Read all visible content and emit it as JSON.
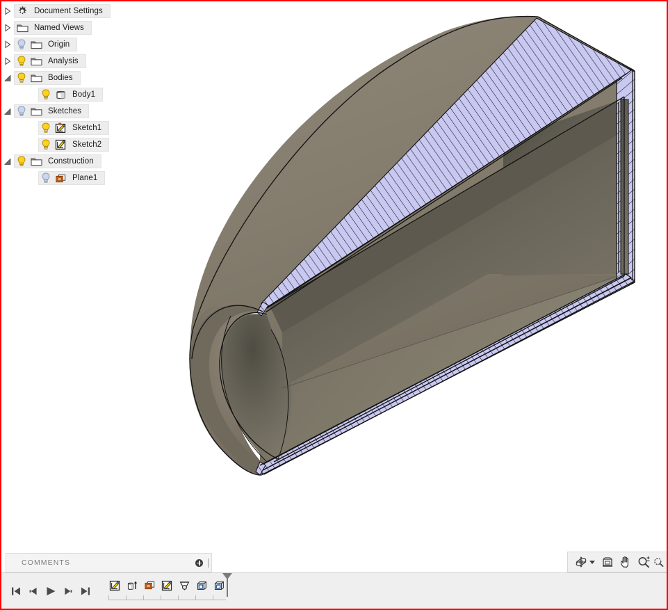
{
  "window": {
    "border_color": "#ff0000",
    "canvas_background": "#ffffff"
  },
  "browser": {
    "name": "browser-tree",
    "items": [
      {
        "label": "Document Settings",
        "icon": "gear-icon",
        "expander": "collapsed",
        "bulb": "none",
        "depth": 0
      },
      {
        "label": "Named Views",
        "icon": "folder-icon",
        "expander": "collapsed",
        "bulb": "none",
        "depth": 0
      },
      {
        "label": "Origin",
        "icon": "folder-icon",
        "expander": "collapsed",
        "bulb": "off",
        "depth": 0
      },
      {
        "label": "Analysis",
        "icon": "folder-icon",
        "expander": "collapsed",
        "bulb": "on",
        "depth": 0
      },
      {
        "label": "Bodies",
        "icon": "folder-icon",
        "expander": "expanded",
        "bulb": "on",
        "depth": 0
      },
      {
        "label": "Body1",
        "icon": "body-icon",
        "expander": "none",
        "bulb": "on",
        "depth": 1
      },
      {
        "label": "Sketches",
        "icon": "folder-icon",
        "expander": "expanded",
        "bulb": "off",
        "depth": 0
      },
      {
        "label": "Sketch1",
        "icon": "sketch-pin-icon",
        "expander": "none",
        "bulb": "on",
        "depth": 1
      },
      {
        "label": "Sketch2",
        "icon": "sketch-icon",
        "expander": "none",
        "bulb": "on",
        "depth": 1
      },
      {
        "label": "Construction",
        "icon": "folder-icon",
        "expander": "expanded",
        "bulb": "on",
        "depth": 0
      },
      {
        "label": "Plane1",
        "icon": "plane-icon",
        "expander": "none",
        "bulb": "off",
        "depth": 1
      }
    ]
  },
  "comments": {
    "label": "COMMENTS",
    "add_icon": "plus-circle-icon",
    "grip_icon": "resize-grip-icon"
  },
  "navbar": {
    "buttons": [
      {
        "name": "orbit-icon",
        "title": "Orbit"
      },
      {
        "name": "chevron-down-icon",
        "title": "Orbit options"
      },
      {
        "name": "look-at-icon",
        "title": "Look At"
      },
      {
        "name": "pan-icon",
        "title": "Pan"
      },
      {
        "name": "zoom-icon",
        "title": "Zoom"
      },
      {
        "name": "fit-icon",
        "title": "Fit"
      }
    ]
  },
  "timeline": {
    "playback": [
      {
        "name": "skip-to-start-button",
        "glyph": "skip-start"
      },
      {
        "name": "step-back-button",
        "glyph": "step-back"
      },
      {
        "name": "play-button",
        "glyph": "play"
      },
      {
        "name": "step-forward-button",
        "glyph": "step-forward"
      },
      {
        "name": "skip-to-end-button",
        "glyph": "skip-end"
      }
    ],
    "features": [
      {
        "name": "timeline-feature-sketch1",
        "icon": "sketch-icon",
        "tooltip": "Sketch1"
      },
      {
        "name": "timeline-feature-extrude1",
        "icon": "extrude-icon",
        "tooltip": "Extrude1"
      },
      {
        "name": "timeline-feature-plane1",
        "icon": "plane-icon",
        "tooltip": "Plane1"
      },
      {
        "name": "timeline-feature-sketch2",
        "icon": "sketch-icon",
        "tooltip": "Sketch2"
      },
      {
        "name": "timeline-feature-loft1",
        "icon": "loft-icon",
        "tooltip": "Loft1"
      },
      {
        "name": "timeline-feature-shell1",
        "icon": "shell-icon",
        "tooltip": "Shell1"
      },
      {
        "name": "timeline-feature-fillet1",
        "icon": "fillet-icon",
        "tooltip": "Fillet1"
      }
    ],
    "marker": "timeline-end-marker"
  },
  "model": {
    "name": "lofted-shelled-body",
    "body_color": "#7d7768",
    "body_color_light": "#908a7b",
    "body_color_dark": "#5d5950",
    "inner_color": "#6e6a5e",
    "section_fill": "#c7c7ee",
    "edge_color": "#1a1a1a",
    "description": "Isometric view of a lofted, shelled solid cut by a section plane; cut faces shown with lavender hatching."
  }
}
